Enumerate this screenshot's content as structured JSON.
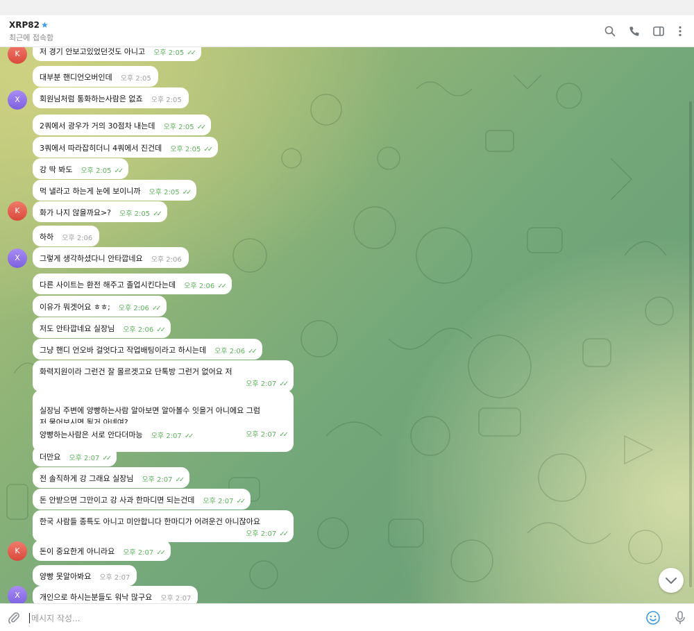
{
  "header": {
    "contact_name": "XRP82",
    "status": "최근에 접속함"
  },
  "composer": {
    "placeholder": "메시지 작성..."
  },
  "messages": [
    {
      "text": "저 경기 안보고있었던것도 아니고",
      "time": "오후 2:05",
      "read": true,
      "avatar": "K"
    },
    {
      "text": "대부분 핸디언오버인데",
      "time": "오후 2:05",
      "read": false,
      "avatar": ""
    },
    {
      "text": "회원님처럼 통화하는사람은 없죠",
      "time": "오후 2:05",
      "read": false,
      "avatar": "X"
    },
    {
      "text": "2쿼에서 광우가 거의 30점차 내는데",
      "time": "오후 2:05",
      "read": true,
      "avatar": ""
    },
    {
      "text": "3쿼에서 따라잡히더니 4쿼에서 진건데",
      "time": "오후 2:05",
      "read": true,
      "avatar": ""
    },
    {
      "text": "강 딱 봐도",
      "time": "오후 2:05",
      "read": true,
      "avatar": ""
    },
    {
      "text": "먹 낼라고 하는게 눈에 보이니까",
      "time": "오후 2:05",
      "read": true,
      "avatar": ""
    },
    {
      "text": "화가 나지 않을까요>?",
      "time": "오후 2:05",
      "read": true,
      "avatar": "K"
    },
    {
      "text": "하하",
      "time": "오후 2:06",
      "read": false,
      "avatar": ""
    },
    {
      "text": "그렇게 생각하셨다니 안타깝네요",
      "time": "오후 2:06",
      "read": false,
      "avatar": "X"
    },
    {
      "text": "다른 사이트는 환전 해주고 졸업시킨다는데",
      "time": "오후 2:06",
      "read": true,
      "avatar": ""
    },
    {
      "text": "이유가 뭐겟어요 ㅎㅎ;",
      "time": "오후 2:06",
      "read": true,
      "avatar": ""
    },
    {
      "text": "저도 안타깝네요 실장님",
      "time": "오후 2:06",
      "read": true,
      "avatar": ""
    },
    {
      "text": "그냥 핸디 언오바 걸엇다고 작업배팅이라고 하시는데",
      "time": "오후 2:06",
      "read": true,
      "avatar": ""
    },
    {
      "text": "화력지원이라 그런건 잘 몰르겟고요 단톡방 그런거 없어요 저",
      "time": "오후 2:07",
      "read": true,
      "avatar": ""
    },
    {
      "text": "실장님 주변에 양빵하는사람 알아보면 알아볼수 잇을거 아니에요 그럼\n저 물어보시면 될거 아녜여?",
      "time": "오후 2:07",
      "read": true,
      "avatar": ""
    },
    {
      "text": "양빵하는사람은 서로 안다더마능",
      "time": "오후 2:07",
      "read": true,
      "avatar": ""
    },
    {
      "text": "더만요",
      "time": "오후 2:07",
      "read": true,
      "avatar": ""
    },
    {
      "text": "전 솔직하게 강 그래요 실장님",
      "time": "오후 2:07",
      "read": true,
      "avatar": ""
    },
    {
      "text": "돈 안받으면 그만이고 강 사과 한마디면 되는건데",
      "time": "오후 2:07",
      "read": true,
      "avatar": ""
    },
    {
      "text": "한국 사람들 종특도 아니고 미안합니다 한마디가 어려운건 아니잖아요",
      "time": "오후 2:07",
      "read": true,
      "avatar": ""
    },
    {
      "text": "돈이 중요한게 아니라요",
      "time": "오후 2:07",
      "read": true,
      "avatar": "K"
    },
    {
      "text": "양빵 못알아봐요",
      "time": "오후 2:07",
      "read": false,
      "avatar": ""
    },
    {
      "text": "개인으로 하시는분들도 워낙 많구요",
      "time": "오후 2:07",
      "read": false,
      "avatar": "X"
    }
  ],
  "colors": {
    "bubble": "#ffffff",
    "read_ticks": "#5bb25a",
    "avatar_k": "#e0584a",
    "avatar_x": "#8a6ee8",
    "star": "#3a9be8"
  },
  "icons": [
    "search-icon",
    "phone-icon",
    "sidebar-toggle-icon",
    "more-vertical-icon",
    "paperclip-icon",
    "emoji-icon",
    "microphone-icon",
    "chevron-down-icon",
    "star-icon"
  ]
}
